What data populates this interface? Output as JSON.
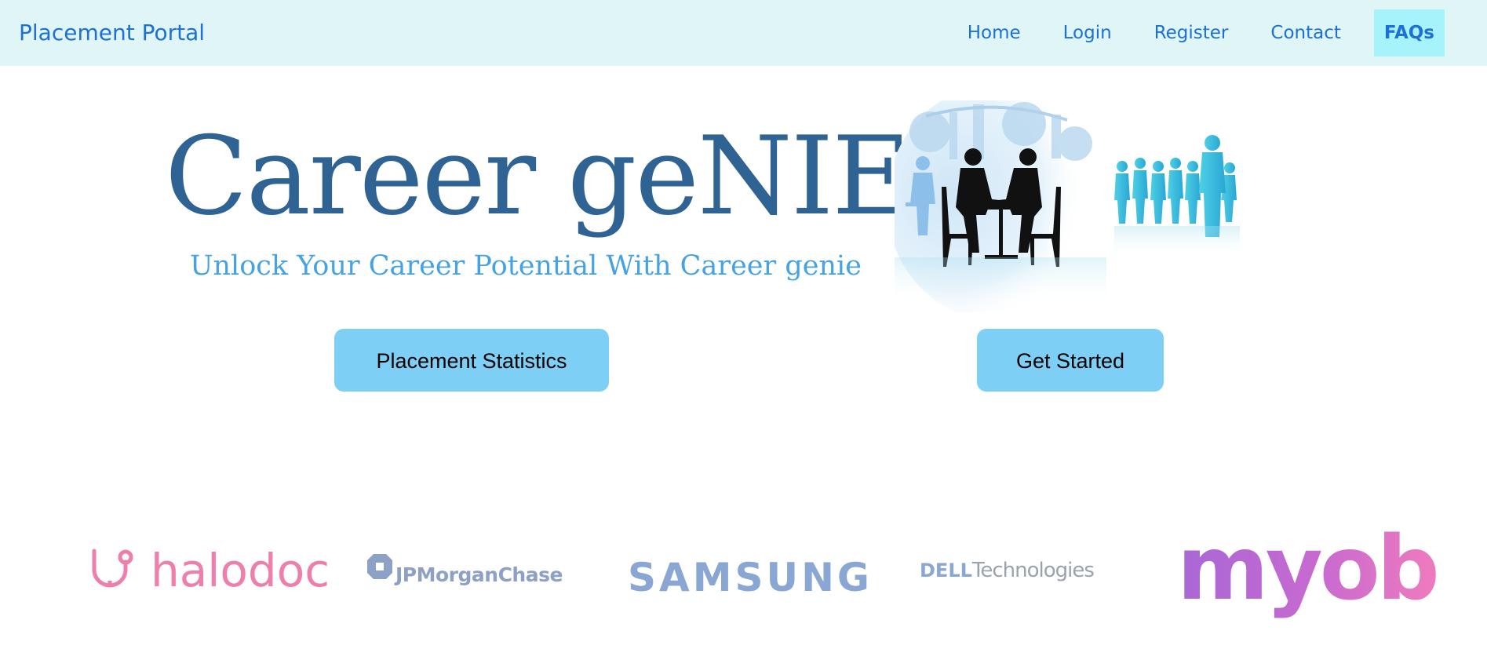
{
  "navbar": {
    "brand": "Placement Portal",
    "links": [
      {
        "label": "Home"
      },
      {
        "label": "Login"
      },
      {
        "label": "Register"
      },
      {
        "label": "Contact"
      },
      {
        "label": "FAQs",
        "active": true
      }
    ]
  },
  "hero": {
    "title": "Career geNIE",
    "subtitle": "Unlock Your Career Potential With Career genie",
    "illustration_icon": "business-meeting-silhouette-icon"
  },
  "buttons": {
    "placement_statistics": "Placement Statistics",
    "get_started": "Get Started"
  },
  "logos": {
    "halodoc": "halodoc",
    "jpmorgan": "JPMorganChase",
    "samsung": "SAMSUNG",
    "dell_word": "DELL",
    "dell_tech": "Technologies",
    "myob": "myob"
  },
  "colors": {
    "navbar_bg": "#dff5f6",
    "link": "#1d70d6",
    "active_link_bg": "#a6f3fb",
    "title": "#2f6394",
    "subtitle": "#45a2e4",
    "button_bg": "#7ecff6"
  }
}
